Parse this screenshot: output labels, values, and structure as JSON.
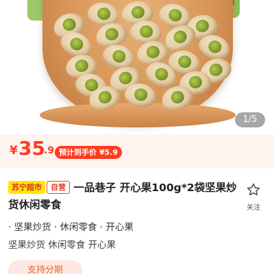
{
  "gallery": {
    "counter": "1/5"
  },
  "price": {
    "currency": "¥",
    "integer": "35",
    "decimal": ".9",
    "promo_label": "预计到手价 ¥5.9"
  },
  "product": {
    "store_badge": "苏宁超市",
    "self_badge": "自营",
    "title": "一品巷子 开心果100g*2袋坚果炒货休闲零食"
  },
  "follow": {
    "label": "关注",
    "icon": "star-outline-icon"
  },
  "tags": {
    "category_line": "· 坚果炒货 · 休闲零食 · 开心果",
    "sub_line": "坚果炒货 休闲零食 开心果"
  },
  "services": {
    "installment_label": "支持分期"
  },
  "colors": {
    "price_red": "#ff3b1f",
    "store_badge_yellow": "#ffe600",
    "installment_bg": "#fde9e2"
  }
}
